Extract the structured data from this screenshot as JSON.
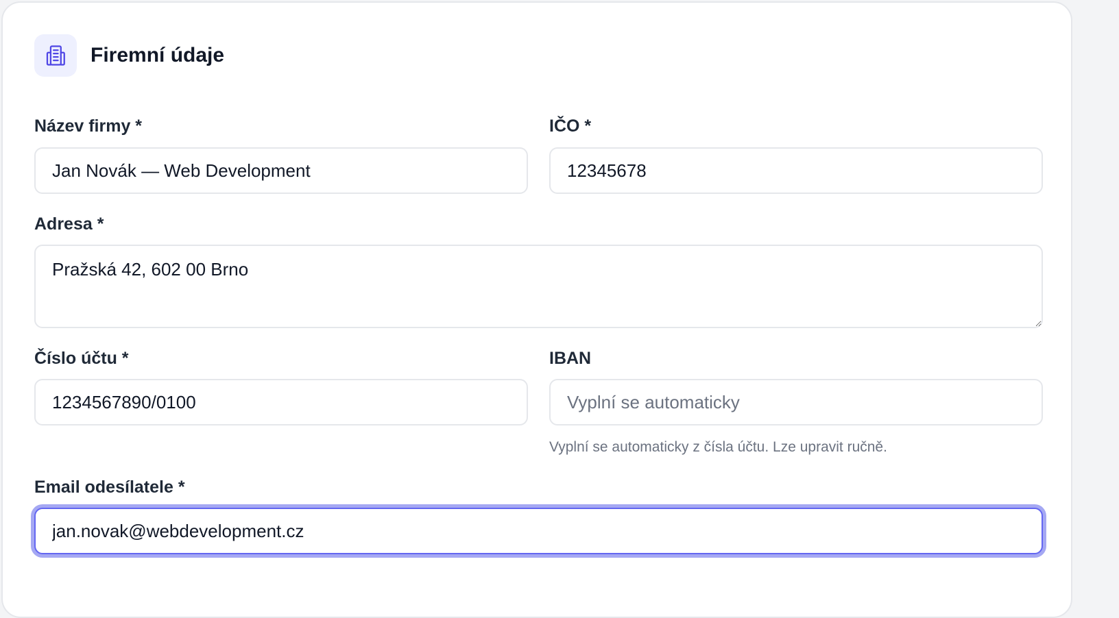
{
  "section": {
    "title": "Firemní údaje",
    "icon": "building-icon"
  },
  "form": {
    "company_name": {
      "label": "Název firmy *",
      "value": "Jan Novák — Web Development"
    },
    "ico": {
      "label": "IČO *",
      "value": "12345678"
    },
    "address": {
      "label": "Adresa *",
      "value": "Pražská 42, 602 00 Brno"
    },
    "account_number": {
      "label": "Číslo účtu *",
      "value": "1234567890/0100"
    },
    "iban": {
      "label": "IBAN",
      "value": "",
      "placeholder": "Vyplní se automaticky",
      "hint": "Vyplní se automaticky z čísla účtu. Lze upravit ručně."
    },
    "sender_email": {
      "label": "Email odesílatele *",
      "value": "jan.novak@webdevelopment.cz"
    }
  },
  "colors": {
    "accent": "#6366f1",
    "icon_bg": "#eef0fe",
    "border": "#e5e7eb",
    "hint_text": "#6b7280"
  }
}
